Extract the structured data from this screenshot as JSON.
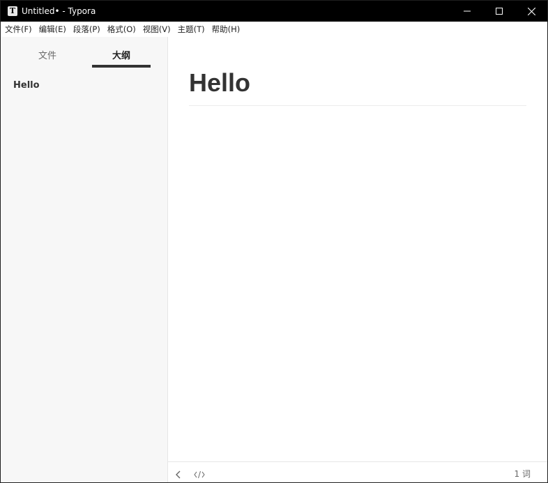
{
  "window": {
    "title": "Untitled• - Typora",
    "app_icon_letter": "T"
  },
  "menu": [
    {
      "label": "文件(F)"
    },
    {
      "label": "编辑(E)"
    },
    {
      "label": "段落(P)"
    },
    {
      "label": "格式(O)"
    },
    {
      "label": "视图(V)"
    },
    {
      "label": "主题(T)"
    },
    {
      "label": "帮助(H)"
    }
  ],
  "sidebar": {
    "tabs": [
      {
        "label": "文件",
        "active": false
      },
      {
        "label": "大纲",
        "active": true
      }
    ],
    "outline": [
      {
        "label": "Hello"
      }
    ]
  },
  "editor": {
    "heading": "Hello"
  },
  "statusbar": {
    "word_count": "1 词"
  },
  "icons": {
    "minimize": "minimize-icon",
    "maximize": "maximize-icon",
    "close": "close-icon",
    "back": "chevron-left-icon",
    "source": "code-icon"
  }
}
